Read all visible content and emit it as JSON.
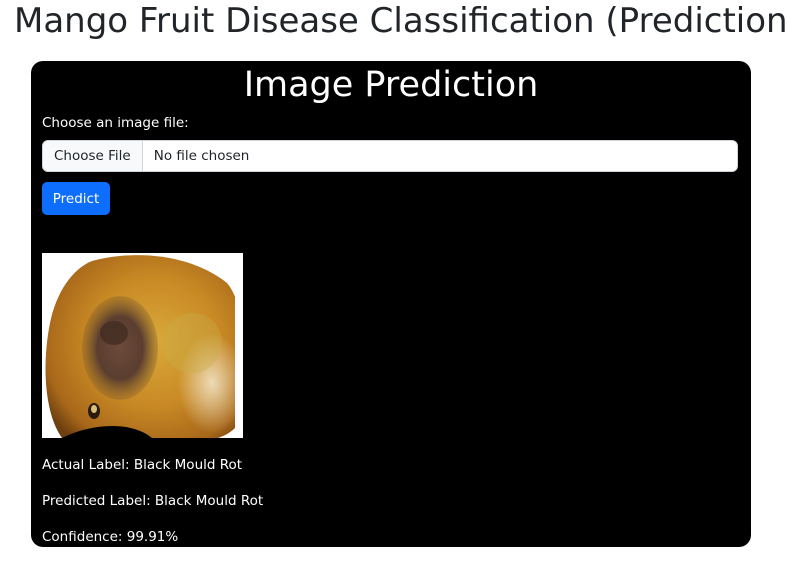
{
  "page": {
    "title": "Mango Fruit Disease Classification (Prediction)"
  },
  "card": {
    "title": "Image Prediction",
    "file_label": "Choose an image file:",
    "file_button": "Choose File",
    "file_status": "No file chosen",
    "predict_button": "Predict"
  },
  "image": {
    "subject": "mango fruit with black mould rot lesion"
  },
  "results": {
    "actual": "Actual Label: Black Mould Rot",
    "predicted": "Predicted Label: Black Mould Rot",
    "confidence": "Confidence: 99.91%"
  },
  "colors": {
    "card_bg": "#000000",
    "primary_button": "#0d6efd",
    "title_text": "#212529"
  }
}
